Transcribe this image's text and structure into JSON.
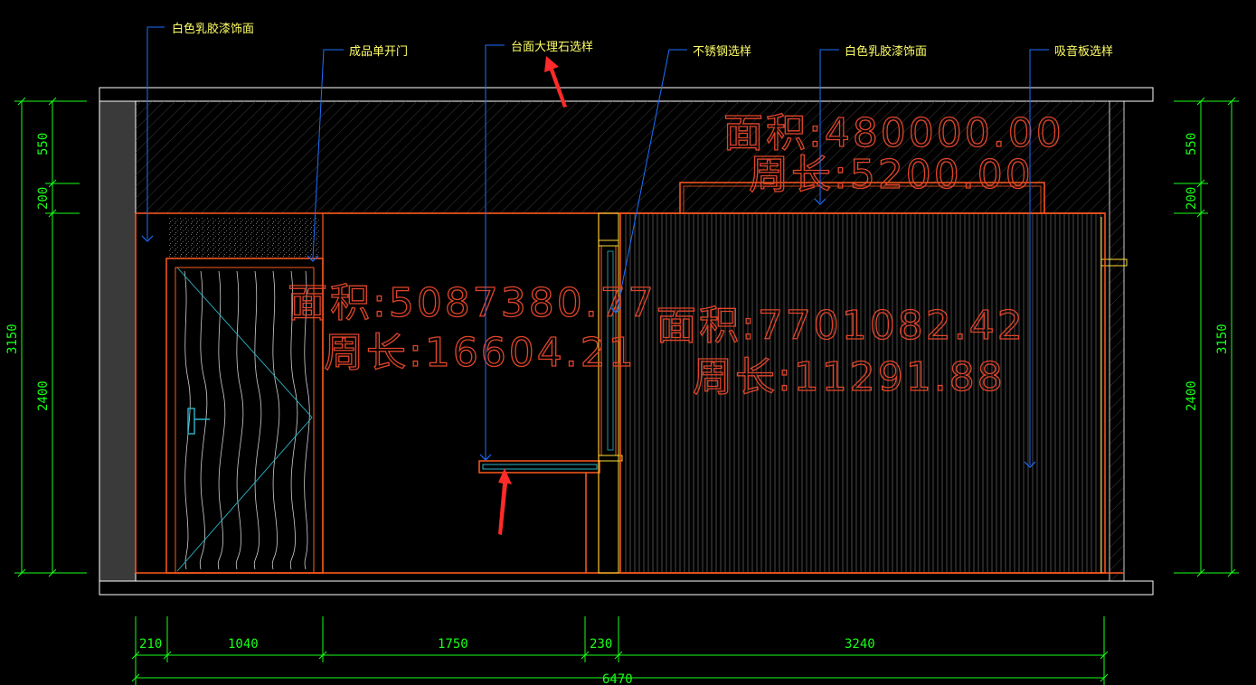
{
  "colors": {
    "background": "#000000",
    "wall_orange": "#ff5a1f",
    "dimension_green": "#19ff19",
    "callout_blue": "#1e6fff",
    "callout_text": "#ffff66",
    "outline_white": "#ffffff",
    "area_text": "#e0452a",
    "arrow_red": "#ff2a2a",
    "door_cyan": "#2bb6c8"
  },
  "callouts": [
    {
      "id": "latex-top-left",
      "text": "白色乳胶漆饰面"
    },
    {
      "id": "door",
      "text": "成品单开门"
    },
    {
      "id": "marble",
      "text": "台面大理石选样"
    },
    {
      "id": "stainless",
      "text": "不锈钢选样"
    },
    {
      "id": "latex-top-right",
      "text": "白色乳胶漆饰面"
    },
    {
      "id": "acoustic",
      "text": "吸音板选样"
    }
  ],
  "areas": [
    {
      "id": "ceiling",
      "area": "面积:480000.00",
      "perimeter": "周长:5200.00"
    },
    {
      "id": "wall-left",
      "area": "面积:5087380.77",
      "perimeter": "周长:16604.21"
    },
    {
      "id": "wall-right",
      "area": "面积:7701082.42",
      "perimeter": "周长:11291.88"
    }
  ],
  "dimensions": {
    "left_vertical": {
      "total": "3150",
      "segments": [
        "550",
        "200",
        "2400"
      ]
    },
    "right_vertical": {
      "total": "3150",
      "segments": [
        "550",
        "200",
        "2400"
      ]
    },
    "bottom": {
      "segments": [
        "210",
        "1040",
        "1750",
        "230",
        "3240"
      ],
      "total": "6470"
    }
  },
  "icons": [
    "red-arrow-icon",
    "red-arrow-icon",
    "door-handle-icon"
  ]
}
